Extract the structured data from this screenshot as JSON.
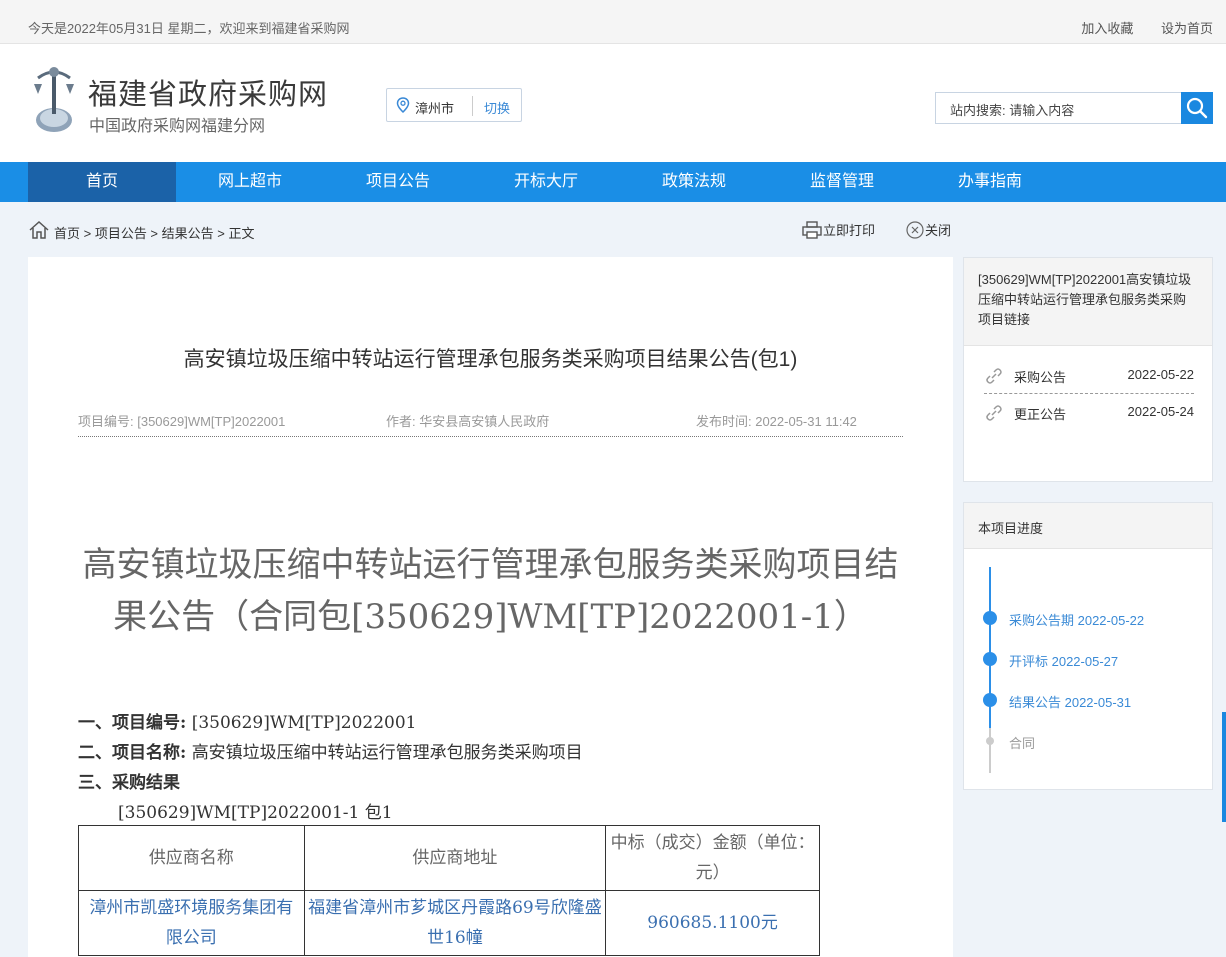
{
  "topbar": {
    "welcome": "今天是2022年05月31日 星期二，欢迎来到福建省采购网",
    "bookmark": "加入收藏",
    "homepage": "设为首页"
  },
  "header": {
    "title": "福建省政府采购网",
    "subtitle": "中国政府采购网福建分网",
    "city": "漳州市",
    "city_switch": "切换",
    "search_label": "站内搜索: 请输入内容"
  },
  "nav": {
    "items": [
      "首页",
      "网上超市",
      "项目公告",
      "开标大厅",
      "政策法规",
      "监督管理",
      "办事指南"
    ]
  },
  "breadcrumb": {
    "text": "首页 > 项目公告 > 结果公告 > 正文",
    "print": "立即打印",
    "close": "关闭"
  },
  "article": {
    "title": "高安镇垃圾压缩中转站运行管理承包服务类采购项目结果公告(包1)",
    "meta_no": "项目编号: [350629]WM[TP]2022001",
    "meta_author": "作者: 华安县高安镇人民政府",
    "meta_time": "发布时间: 2022-05-31 11:42",
    "big_title": "高安镇垃圾压缩中转站运行管理承包服务类采购项目结果公告（合同包[350629]WM[TP]2022001-1）",
    "sec1_label": "一、项目编号:",
    "sec1_value": "[350629]WM[TP]2022001",
    "sec2_label": "二、项目名称:",
    "sec2_value": "高安镇垃圾压缩中转站运行管理承包服务类采购项目",
    "sec3_label": "三、采购结果",
    "package": "[350629]WM[TP]2022001-1 包1",
    "table": {
      "headers": [
        "供应商名称",
        "供应商地址",
        "中标（成交）金额（单位：元）"
      ],
      "row": [
        "漳州市凯盛环境服务集团有限公司",
        "福建省漳州市芗城区丹霞路69号欣隆盛世16幢",
        "960685.1100元"
      ]
    }
  },
  "side_links": {
    "title": "[350629]WM[TP]2022001高安镇垃圾压缩中转站运行管理承包服务类采购项目链接",
    "items": [
      {
        "name": "采购公告",
        "date": "2022-05-22"
      },
      {
        "name": "更正公告",
        "date": "2022-05-24"
      }
    ]
  },
  "progress": {
    "title": "本项目进度",
    "steps": [
      {
        "label": "采购公告期 2022-05-22",
        "done": true
      },
      {
        "label": "开评标 2022-05-27",
        "done": true
      },
      {
        "label": "结果公告 2022-05-31",
        "done": true
      },
      {
        "label": "合同",
        "done": false
      }
    ]
  },
  "colors": {
    "nav_bg": "#1a8ee6",
    "nav_active": "#1b62a8",
    "link": "#3a8ad6"
  }
}
